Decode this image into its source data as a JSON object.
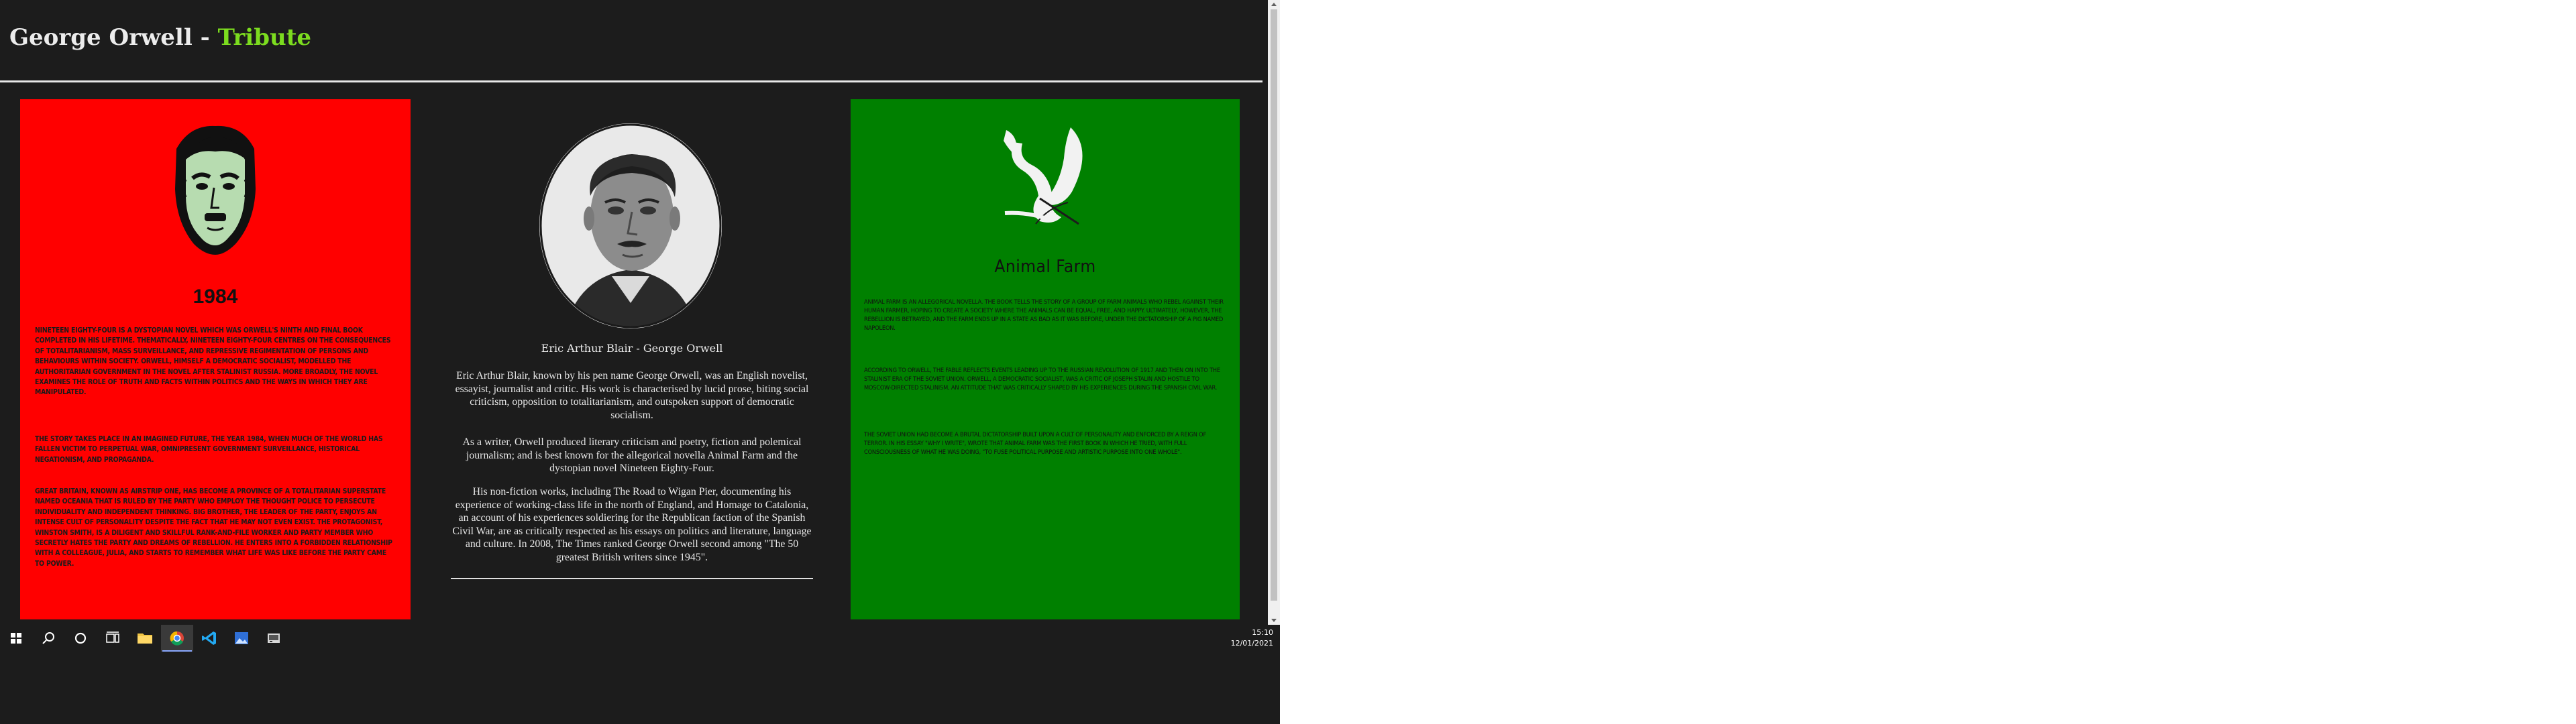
{
  "header": {
    "title_main": "George Orwell - ",
    "title_accent": "Tribute"
  },
  "cards": {
    "left": {
      "title": "1984",
      "paragraphs": [
        "Nineteen Eighty-Four is a dystopian novel which was Orwell's ninth and final book completed in his lifetime. Thematically, Nineteen Eighty-Four centres on the consequences of totalitarianism, mass surveillance, and repressive regimentation of persons and behaviours within society. Orwell, himself a democratic socialist, modelled the authoritarian government in the novel after Stalinist Russia. More broadly, the novel examines the role of truth and facts within politics and the ways in which they are manipulated.",
        "The story takes place in an imagined future, the year 1984, when much of the world has fallen victim to perpetual war, omnipresent government surveillance, historical negationism, and propaganda.",
        "Great Britain, known as Airstrip One, has become a province of a totalitarian superstate named Oceania that is ruled by the Party who employ the Thought Police to persecute individuality and independent thinking. Big Brother, the leader of the Party, enjoys an intense cult of personality despite the fact that he may not even exist. The protagonist, Winston Smith, is a diligent and skillful rank-and-file worker and Party member who secretly hates the Party and dreams of rebellion. He enters into a forbidden relationship with a colleague, Julia, and starts to remember what life was like before the Party came to power."
      ]
    },
    "middle": {
      "caption": "Eric Arthur Blair - George Orwell",
      "paragraphs": [
        "Eric Arthur Blair, known by his pen name George Orwell, was an English novelist, essayist, journalist and critic. His work is characterised by lucid prose, biting social criticism, opposition to totalitarianism, and outspoken support of democratic socialism.",
        "As a writer, Orwell produced literary criticism and poetry, fiction and polemical journalism; and is best known for the allegorical novella Animal Farm and the dystopian novel Nineteen Eighty-Four.",
        "His non-fiction works, including The Road to Wigan Pier, documenting his experience of working-class life in the north of England, and Homage to Catalonia, an account of his experiences soldiering for the Republican faction of the Spanish Civil War, are as critically respected as his essays on politics and literature, language and culture. In 2008, The Times ranked George Orwell second among \"The 50 greatest British writers since 1945\"."
      ]
    },
    "right": {
      "title": "Animal Farm",
      "paragraphs": [
        "Animal Farm is an allegorical novella. The book tells the story of a group of farm animals who rebel against their human farmer, hoping to create a society where the animals can be equal, free, and happy. Ultimately, however, the rebellion is betrayed, and the farm ends up in a state as bad as it was before, under the dictatorship of a pig named Napoleon.",
        "According to Orwell, the fable reflects events leading up to the Russian Revolution of 1917 and then on into the Stalinist era of the Soviet Union. Orwell, a democratic socialist, was a critic of Joseph Stalin and hostile to Moscow-directed Stalinism, an attitude that was critically shaped by his experiences during the Spanish Civil War.",
        "The Soviet Union had become a brutal dictatorship built upon a cult of personality and enforced by a reign of terror. In his essay \"Why I Write\", wrote that Animal Farm was the first book in which he tried, with full consciousness of what he was doing, \"to fuse political purpose and artistic purpose into one whole\"."
      ]
    }
  },
  "taskbar": {
    "icons": [
      "windows-start-icon",
      "search-icon",
      "cortana-icon",
      "task-view-icon",
      "file-explorer-icon",
      "chrome-icon",
      "vscode-icon",
      "photos-icon",
      "app-icon"
    ],
    "time": "15:10",
    "date": "12/01/2021"
  },
  "colors": {
    "page_bg": "#1c1c1c",
    "accent": "#7cdc1f",
    "left_card": "#ff0000",
    "right_card": "#008000"
  }
}
